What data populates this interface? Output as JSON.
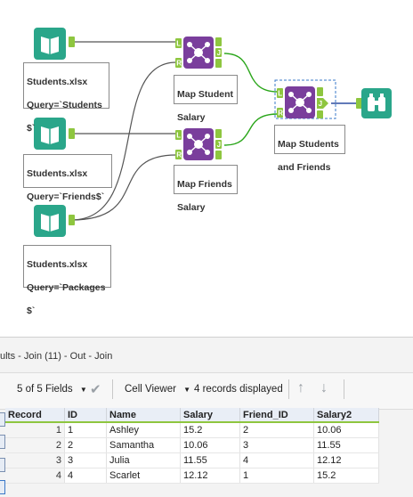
{
  "workflow": {
    "inputs": [
      {
        "annotation": [
          "Students.xlsx",
          "Query=`Students",
          "$`"
        ]
      },
      {
        "annotation": [
          "Students.xlsx",
          "Query=`Friends$`"
        ]
      },
      {
        "annotation": [
          "Students.xlsx",
          "Query=`Packages",
          "$`"
        ]
      }
    ],
    "joins": [
      {
        "annotation": [
          "Map Student",
          "Salary"
        ]
      },
      {
        "annotation": [
          "Map Friends",
          "Salary"
        ]
      },
      {
        "annotation": [
          "Map Students",
          "and Friends"
        ]
      }
    ],
    "anchor_labels": {
      "left": "L",
      "right": "R",
      "join": "J"
    },
    "colors": {
      "input_icon": "#2aa68a",
      "join_icon": "#7a3e9c",
      "browse_icon": "#2aa68a",
      "anchor": "#8ec63f",
      "wire": "#555555",
      "wire_selected": "#2aa61a"
    }
  },
  "results": {
    "title": "ults - Join (11) - Out - Join",
    "fields_label": "5 of 5 Fields",
    "cell_viewer_label": "Cell Viewer",
    "records_label": "4 records displayed",
    "columns": [
      "Record",
      "ID",
      "Name",
      "Salary",
      "Friend_ID",
      "Salary2"
    ],
    "rows": [
      [
        "1",
        "1",
        "Ashley",
        "15.2",
        "2",
        "10.06"
      ],
      [
        "2",
        "2",
        "Samantha",
        "10.06",
        "3",
        "11.55"
      ],
      [
        "3",
        "3",
        "Julia",
        "11.55",
        "4",
        "12.12"
      ],
      [
        "4",
        "4",
        "Scarlet",
        "12.12",
        "1",
        "15.2"
      ]
    ]
  }
}
